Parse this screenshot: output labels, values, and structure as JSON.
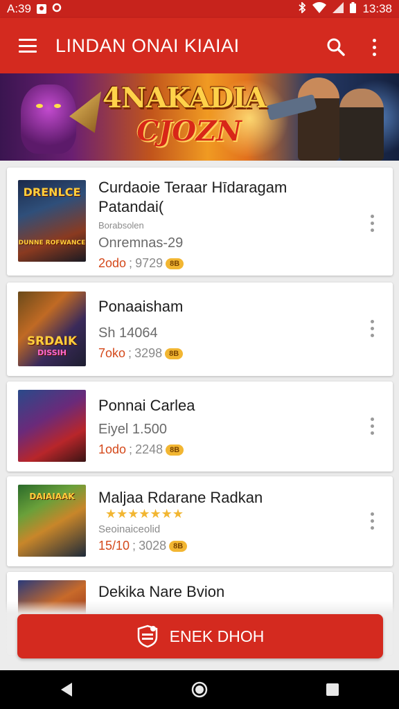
{
  "status_bar": {
    "time_left": "A:39",
    "time_right": "13:38"
  },
  "app_bar": {
    "title": "LINDAN ONAI KIAIAI"
  },
  "banner": {
    "title": "4NAKADIA",
    "subtitle": "CJOZN"
  },
  "games": [
    {
      "thumb_label": "DRENLCE",
      "thumb_label2": "DUNNE ROFWANCE",
      "title": "Curdaoie Teraar Hīdaragam",
      "title2": "Patandai(",
      "tag": "Borabsolen",
      "subtitle": "Onremnas-29",
      "meta_a": "2odo",
      "meta_b": "9729",
      "badge": "8B"
    },
    {
      "thumb_label": "SRDAIK",
      "thumb_label2": "DISSIH",
      "title": "Ponaaisham",
      "subtitle": "Sh 14064",
      "meta_a": "7oko",
      "meta_b": "3298",
      "badge": "8B"
    },
    {
      "thumb_label": "",
      "title": "Ponnai Carlea",
      "subtitle": "Eiyel 1.500",
      "meta_a": "1odo",
      "meta_b": "2248",
      "badge": "8B"
    },
    {
      "thumb_label": "DAIAIAAK",
      "title": "Maljaa Rdarane Radkan",
      "stars": "★★★★★★★",
      "tag": "Seoinaiceolid",
      "meta_a": "15/10",
      "meta_b": "3028",
      "badge": "8B"
    },
    {
      "thumb_label": "",
      "title": "Dekika Nare Bvion"
    }
  ],
  "cta": {
    "label": "ENEK DHOH"
  },
  "colors": {
    "primary": "#d42a1f",
    "status": "#c7231c",
    "accent": "#d4481a",
    "star": "#f2b632"
  }
}
